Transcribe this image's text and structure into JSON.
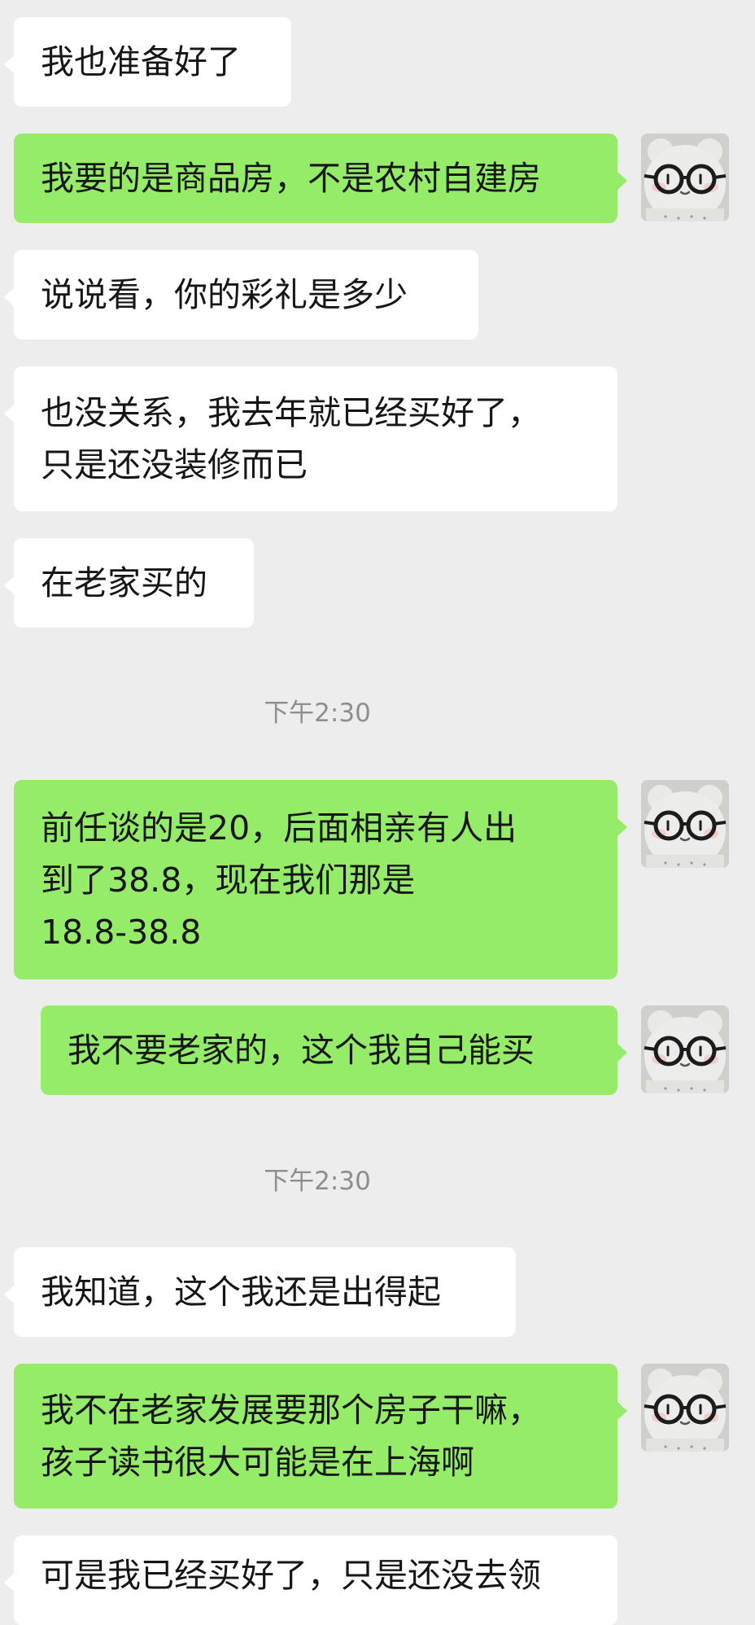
{
  "messages": [
    {
      "side": "left",
      "lines": [
        "我也准备好了"
      ]
    },
    {
      "side": "right",
      "lines": [
        "我要的是商品房，不是农村自建房"
      ]
    },
    {
      "side": "left",
      "lines": [
        "说说看，你的彩礼是多少"
      ]
    },
    {
      "side": "left",
      "lines": [
        "也没关系，我去年就已经买好了，",
        "只是还没装修而已"
      ]
    },
    {
      "side": "left",
      "lines": [
        "在老家买的"
      ]
    },
    {
      "time": "下午2:30"
    },
    {
      "side": "right",
      "lines": [
        "前任谈的是20，后面相亲有人出",
        "到了38.8，现在我们那是",
        "18.8-38.8"
      ]
    },
    {
      "side": "right",
      "lines": [
        "我不要老家的，这个我自己能买"
      ]
    },
    {
      "time": "下午2:30"
    },
    {
      "side": "left",
      "lines": [
        "我知道，这个我还是出得起"
      ]
    },
    {
      "side": "right",
      "lines": [
        "我不在老家发展要那个房子干嘛，",
        "孩子读书很大可能是在上海啊"
      ]
    },
    {
      "side": "left",
      "lines": [
        "可是我已经买好了，只是还没去领"
      ]
    }
  ],
  "avatar": {
    "icon": "bear-with-glasses-avatar"
  },
  "colors": {
    "background": "#ededed",
    "incoming": "#ffffff",
    "outgoing": "#95ec69",
    "timestamp": "#8e8e8e"
  }
}
